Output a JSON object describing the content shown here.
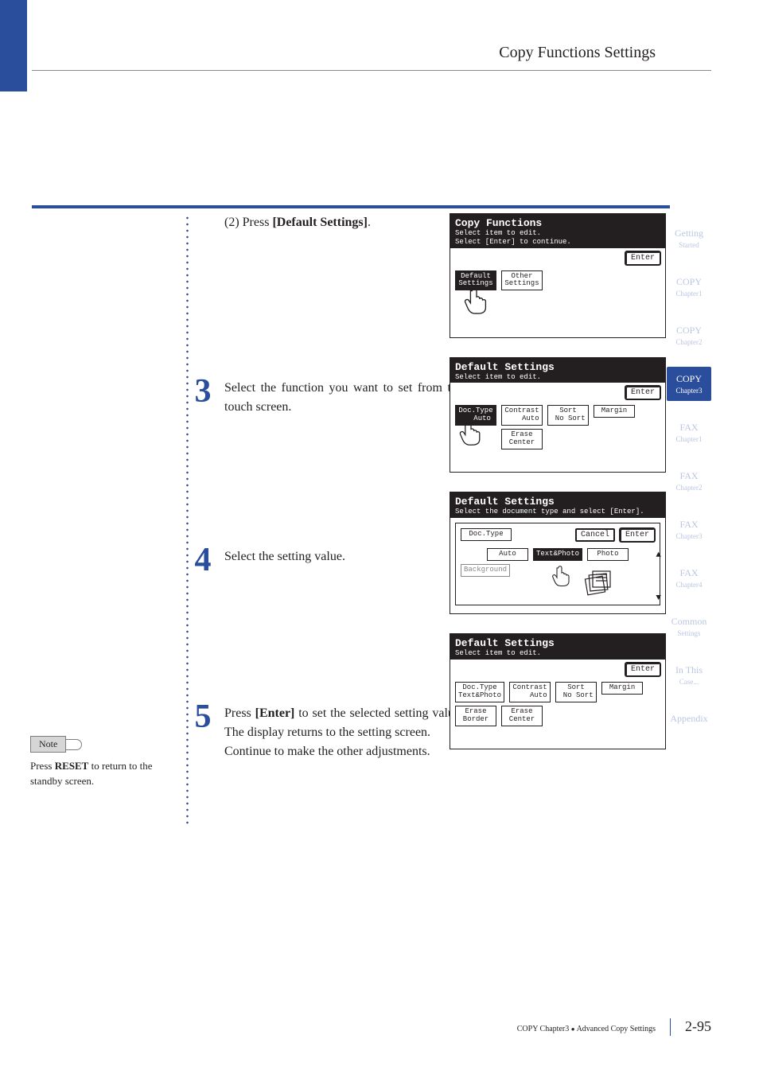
{
  "header": {
    "section_title": "Copy Functions Settings"
  },
  "tabs": {
    "list": [
      {
        "t1": "Getting",
        "t2": "Started",
        "active": false
      },
      {
        "t1": "COPY",
        "t2": "Chapter1",
        "active": false
      },
      {
        "t1": "COPY",
        "t2": "Chapter2",
        "active": false
      },
      {
        "t1": "COPY",
        "t2": "Chapter3",
        "active": true
      },
      {
        "t1": "FAX",
        "t2": "Chapter1",
        "active": false
      },
      {
        "t1": "FAX",
        "t2": "Chapter2",
        "active": false
      },
      {
        "t1": "FAX",
        "t2": "Chapter3",
        "active": false
      },
      {
        "t1": "FAX",
        "t2": "Chapter4",
        "active": false
      },
      {
        "t1": "Common",
        "t2": "Settings",
        "active": false
      },
      {
        "t1": "In This",
        "t2": "Case...",
        "active": false
      },
      {
        "t1": "Appendix",
        "t2": "",
        "active": false
      }
    ]
  },
  "steps": {
    "s2": {
      "prefix": "(2)",
      "text_before": "Press ",
      "bold": "[Default Settings]",
      "text_after": "."
    },
    "s3": {
      "num": "3",
      "text": "Select the function you want to set from the touch screen."
    },
    "s4": {
      "num": "4",
      "text": "Select the setting value."
    },
    "s5": {
      "num": "5",
      "para1_a": "Press ",
      "para1_b": "[Enter]",
      "para1_c": " to set the selected setting value. The display returns to the setting screen.",
      "para2": "Continue to make the other adjustments."
    }
  },
  "note": {
    "label": "Note",
    "text_a": "Press ",
    "text_b": "RESET",
    "text_c": " to return to the standby screen."
  },
  "lcd1": {
    "title": "Copy Functions",
    "sub1": "Select item to edit.",
    "sub2": "Select [Enter] to continue.",
    "enter": "Enter",
    "btn_default": "Default\nSettings",
    "btn_other": "Other\nSettings"
  },
  "lcd2": {
    "title": "Default Settings",
    "sub": "Select item to edit.",
    "enter": "Enter",
    "cells": {
      "doctype": "Doc.Type\n   Auto",
      "contrast": "Contrast\n    Auto",
      "sort": "Sort\n No Sort",
      "margin": "Margin",
      "erase": "Erase\nCenter"
    }
  },
  "lcd3": {
    "title": "Default Settings",
    "sub": "Select the document type and select [Enter].",
    "panel_label": "Doc.Type",
    "cancel": "Cancel",
    "enter": "Enter",
    "auto": "Auto",
    "textphoto": "Text&Photo",
    "photo": "Photo",
    "background": "Background"
  },
  "lcd4": {
    "title": "Default Settings",
    "sub": "Select item to edit.",
    "enter": "Enter",
    "cells": {
      "doctype": "Doc.Type\nText&Photo",
      "contrast": "Contrast\n    Auto",
      "sort": "Sort\n No Sort",
      "margin": "Margin",
      "erase_border": "Erase\nBorder",
      "erase_center": "Erase\nCenter"
    }
  },
  "footer": {
    "crumb_a": "COPY Chapter3",
    "crumb_b": "Advanced Copy Settings",
    "page": "2-95"
  }
}
